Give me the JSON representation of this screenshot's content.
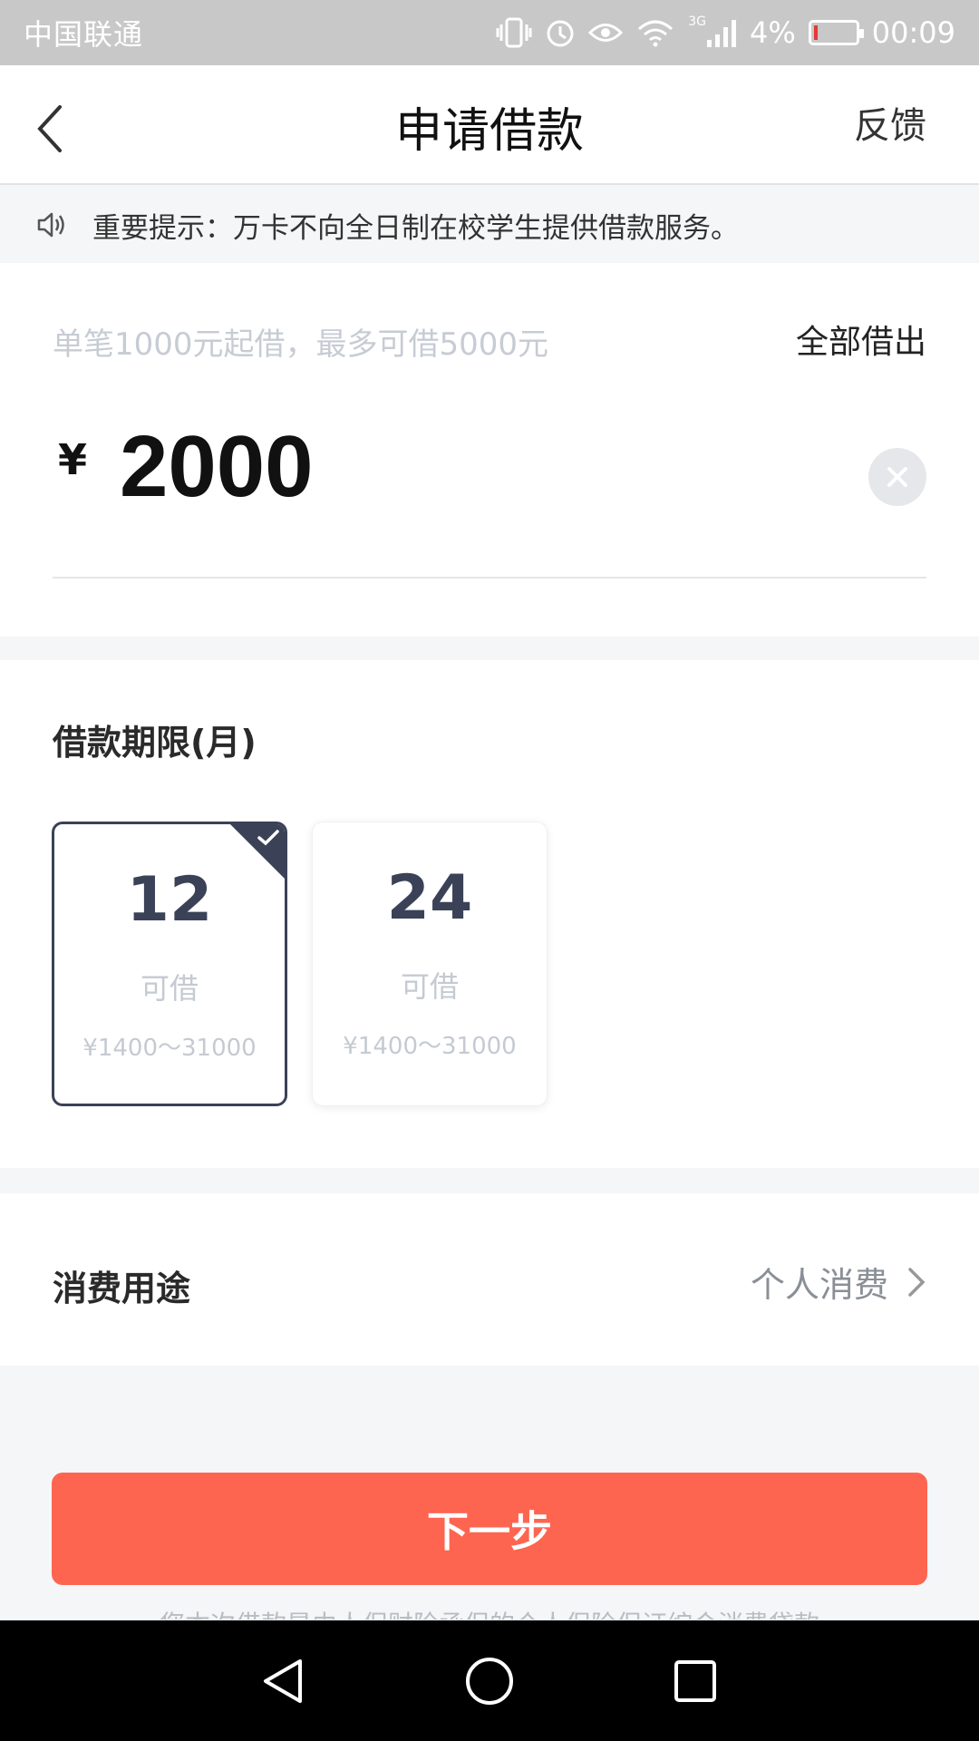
{
  "status_bar": {
    "carrier": "中国联通",
    "network": "3G",
    "battery": "4%",
    "time": "00:09"
  },
  "nav": {
    "title": "申请借款",
    "right_label": "反馈"
  },
  "notice": {
    "text": "重要提示：万卡不向全日制在校学生提供借款服务。"
  },
  "amount": {
    "hint": "单笔1000元起借，最多可借5000元",
    "borrow_all_label": "全部借出",
    "currency": "¥",
    "value": "2000"
  },
  "term": {
    "title": "借款期限(月)",
    "options": [
      {
        "months": "12",
        "label": "可借",
        "range": "¥1400～31000",
        "selected": true
      },
      {
        "months": "24",
        "label": "可借",
        "range": "¥1400～31000",
        "selected": false
      }
    ]
  },
  "purpose": {
    "title": "消费用途",
    "value": "个人消费"
  },
  "footer": {
    "next_label": "下一步",
    "disclaimer": "您本次借款是由人保财险承保的个人保险保证综合消费贷款"
  },
  "colors": {
    "primary": "#fe6550",
    "selected_border": "#3b4257",
    "muted_text": "#c5cad2"
  }
}
